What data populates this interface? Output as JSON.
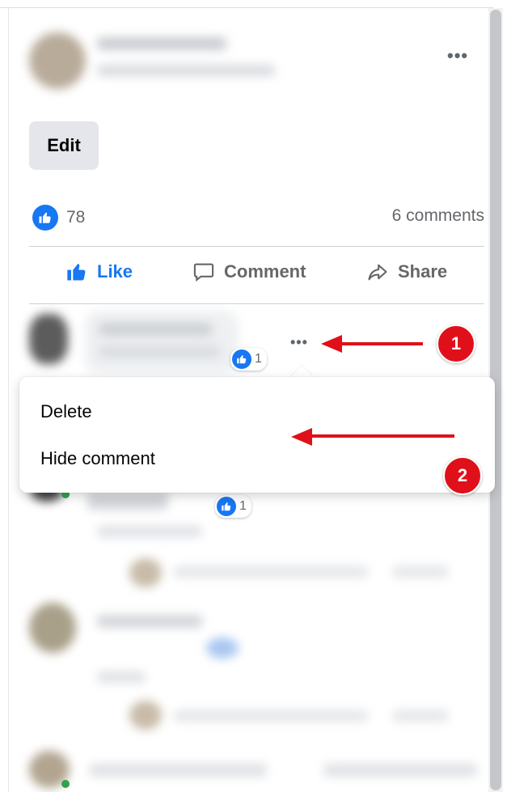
{
  "post": {
    "edit_label": "Edit",
    "reaction_count": "78",
    "comments_count": "6 comments"
  },
  "actions": {
    "like": "Like",
    "comment": "Comment",
    "share": "Share"
  },
  "comment": {
    "reaction_count": "1",
    "reply_reaction_count": "1"
  },
  "menu": {
    "items": [
      "Delete",
      "Hide comment"
    ]
  },
  "annotations": {
    "step1": "1",
    "step2": "2"
  },
  "colors": {
    "brand_blue": "#1877f2",
    "annotation_red": "#e0101a"
  }
}
